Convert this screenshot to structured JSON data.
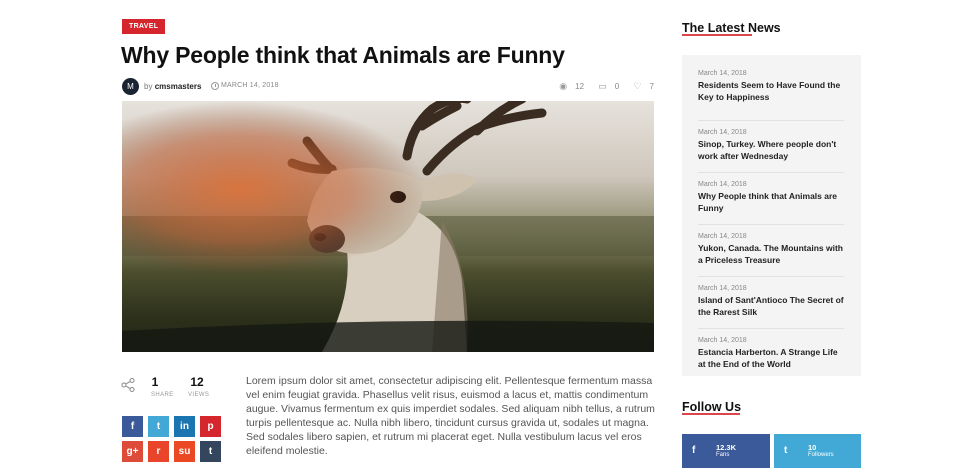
{
  "article": {
    "category": "TRAVEL",
    "title": "Why People think that Animals are Funny",
    "author_prefix": "by",
    "author": "cmsmasters",
    "date": "MARCH 14, 2018",
    "views": "12",
    "comments": "0",
    "likes": "7",
    "shares": "1",
    "shares_label": "SHARE",
    "views_label": "VIEWS",
    "body": "Lorem ipsum dolor sit amet, consectetur adipiscing elit. Pellentesque fermentum massa vel enim feugiat gravida. Phasellus velit risus, euismod a lacus et, mattis condimentum augue. Vivamus fermentum ex quis imperdiet sodales. Sed aliquam nibh tellus, a rutrum turpis pellentesque ac. Nulla nibh libero, tincidunt cursus gravida ut, sodales ut magna. Sed sodales libero sapien, et rutrum mi placerat eget. Nulla vestibulum lacus vel eros eleifend molestie."
  },
  "social_buttons": [
    {
      "name": "facebook",
      "glyph": "f",
      "color": "#3b5a9a"
    },
    {
      "name": "twitter",
      "glyph": "t",
      "color": "#42a9d6"
    },
    {
      "name": "linkedin",
      "glyph": "in",
      "color": "#1b75b0"
    },
    {
      "name": "pinterest",
      "glyph": "p",
      "color": "#d5262d"
    },
    {
      "name": "google-plus",
      "glyph": "g+",
      "color": "#dd4b39"
    },
    {
      "name": "reddit",
      "glyph": "r",
      "color": "#e8452b"
    },
    {
      "name": "stumbleupon",
      "glyph": "su",
      "color": "#eb4924"
    },
    {
      "name": "tumblr",
      "glyph": "t",
      "color": "#34465d"
    }
  ],
  "sidebar": {
    "latest_title": "The Latest News",
    "news": [
      {
        "date": "March 14, 2018",
        "headline": "Residents Seem to Have Found the Key to Happiness"
      },
      {
        "date": "March 14, 2018",
        "headline": "Sinop, Turkey. Where people don't work after Wednesday"
      },
      {
        "date": "March 14, 2018",
        "headline": "Why People think that Animals are Funny"
      },
      {
        "date": "March 14, 2018",
        "headline": "Yukon, Canada. The Mountains with a Priceless Treasure"
      },
      {
        "date": "March 14, 2018",
        "headline": "Island of Sant'Antioco The Secret of the Rarest Silk"
      },
      {
        "date": "March 14, 2018",
        "headline": "Estancia Harberton. A Strange Life at the End of the World"
      }
    ],
    "follow_title": "Follow Us",
    "follow": {
      "facebook": {
        "count": "12.3K",
        "label": "Fans"
      },
      "twitter": {
        "count": "10",
        "label": "Followers"
      }
    }
  },
  "colors": {
    "accent": "#d5262d",
    "facebook": "#3b5a9a",
    "twitter": "#42a9d6"
  }
}
